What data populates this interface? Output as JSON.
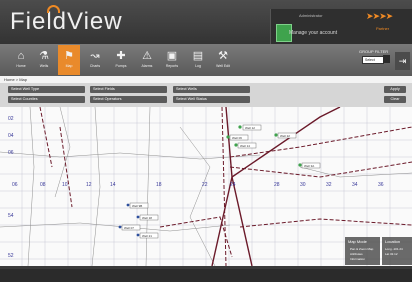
{
  "header": {
    "brand": "FieldView",
    "admin_label": "Administrator",
    "manage_label": "Manage your account",
    "partner_label": "Partner"
  },
  "toolbar": {
    "items": [
      {
        "label": "Home",
        "icon": "home-icon"
      },
      {
        "label": "Wells",
        "icon": "wells-icon"
      },
      {
        "label": "Map",
        "icon": "map-pin-icon",
        "active": true
      },
      {
        "label": "Charts",
        "icon": "chart-icon"
      },
      {
        "label": "Pumps",
        "icon": "pump-icon"
      },
      {
        "label": "Alarms",
        "icon": "warning-icon"
      },
      {
        "label": "Reports",
        "icon": "reports-icon"
      },
      {
        "label": "Log",
        "icon": "log-icon"
      },
      {
        "label": "Well Edit",
        "icon": "wrench-icon"
      }
    ],
    "group_label": "GROUP FILTER",
    "group_value": "Select"
  },
  "breadcrumb": "Home > Map",
  "filters": {
    "well_type": "Select Well Type",
    "fields": "Select Fields",
    "wells": "Select Wells",
    "counties": "Select Counties",
    "operators": "Select Operators",
    "well_status": "Select Well Status",
    "apply": "Apply",
    "clear": "Clear"
  },
  "map": {
    "top_numbers": [
      "08",
      "10",
      "12",
      "14",
      "16",
      "18",
      "20",
      "22",
      "24",
      "26",
      "28",
      "30",
      "32",
      "34",
      "36"
    ],
    "left_numbers": [
      "02",
      "04",
      "06",
      "54",
      "52"
    ],
    "mid_numbers": [
      "06",
      "08",
      "10",
      "12",
      "14",
      "18",
      "22",
      "24",
      "28",
      "30",
      "32",
      "34",
      "36"
    ],
    "well_labels": [
      "Well 12",
      "Well 06",
      "Well 14",
      "Well 22",
      "Well 3A",
      "Well 9B",
      "Well 18",
      "Well 07",
      "Well 21"
    ],
    "legend": {
      "title": "Map Mode",
      "items": [
        "Pan & Zoom Map",
        "Attributes",
        "Information"
      ]
    },
    "location": {
      "title": "Location",
      "lines": [
        "Long -101.24",
        "Lat 32.12"
      ]
    }
  },
  "colors": {
    "accent": "#e98a2b",
    "header": "#3c3c3c",
    "boundary": "#6b1a2a",
    "grid_text": "#3a3a9a"
  }
}
